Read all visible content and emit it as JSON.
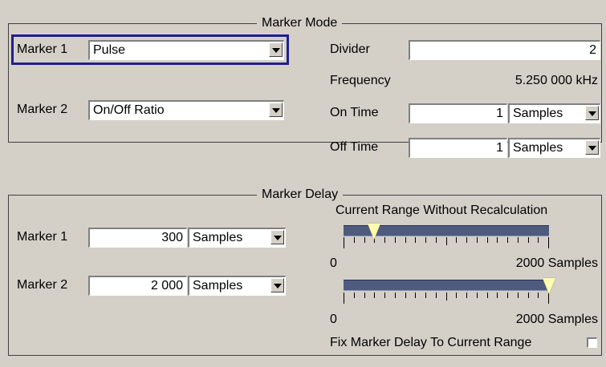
{
  "marker_mode": {
    "title": "Marker Mode",
    "marker1": {
      "label": "Marker 1",
      "value": "Pulse"
    },
    "marker2": {
      "label": "Marker 2",
      "value": "On/Off Ratio"
    },
    "divider": {
      "label": "Divider",
      "value": "2"
    },
    "frequency": {
      "label": "Frequency",
      "value": "5.250 000 kHz"
    },
    "on_time": {
      "label": "On Time",
      "value": "1",
      "unit": "Samples"
    },
    "off_time": {
      "label": "Off Time",
      "value": "1",
      "unit": "Samples"
    }
  },
  "marker_delay": {
    "title": "Marker Delay",
    "range_title": "Current Range Without Recalculation",
    "marker1": {
      "label": "Marker 1",
      "value": "300",
      "unit": "Samples",
      "slider_fraction": 0.15
    },
    "marker2": {
      "label": "Marker 2",
      "value": "2 000",
      "unit": "Samples",
      "slider_fraction": 1.0
    },
    "scale_min": "0",
    "scale_max": "2000 Samples",
    "fix_label": "Fix Marker Delay To Current Range",
    "fix_checked": false
  },
  "colors": {
    "background": "#d4d0c8",
    "focus_frame": "#1f1f8f",
    "slider_bar": "#4f5b7e",
    "slider_thumb": "#fffbb0"
  }
}
